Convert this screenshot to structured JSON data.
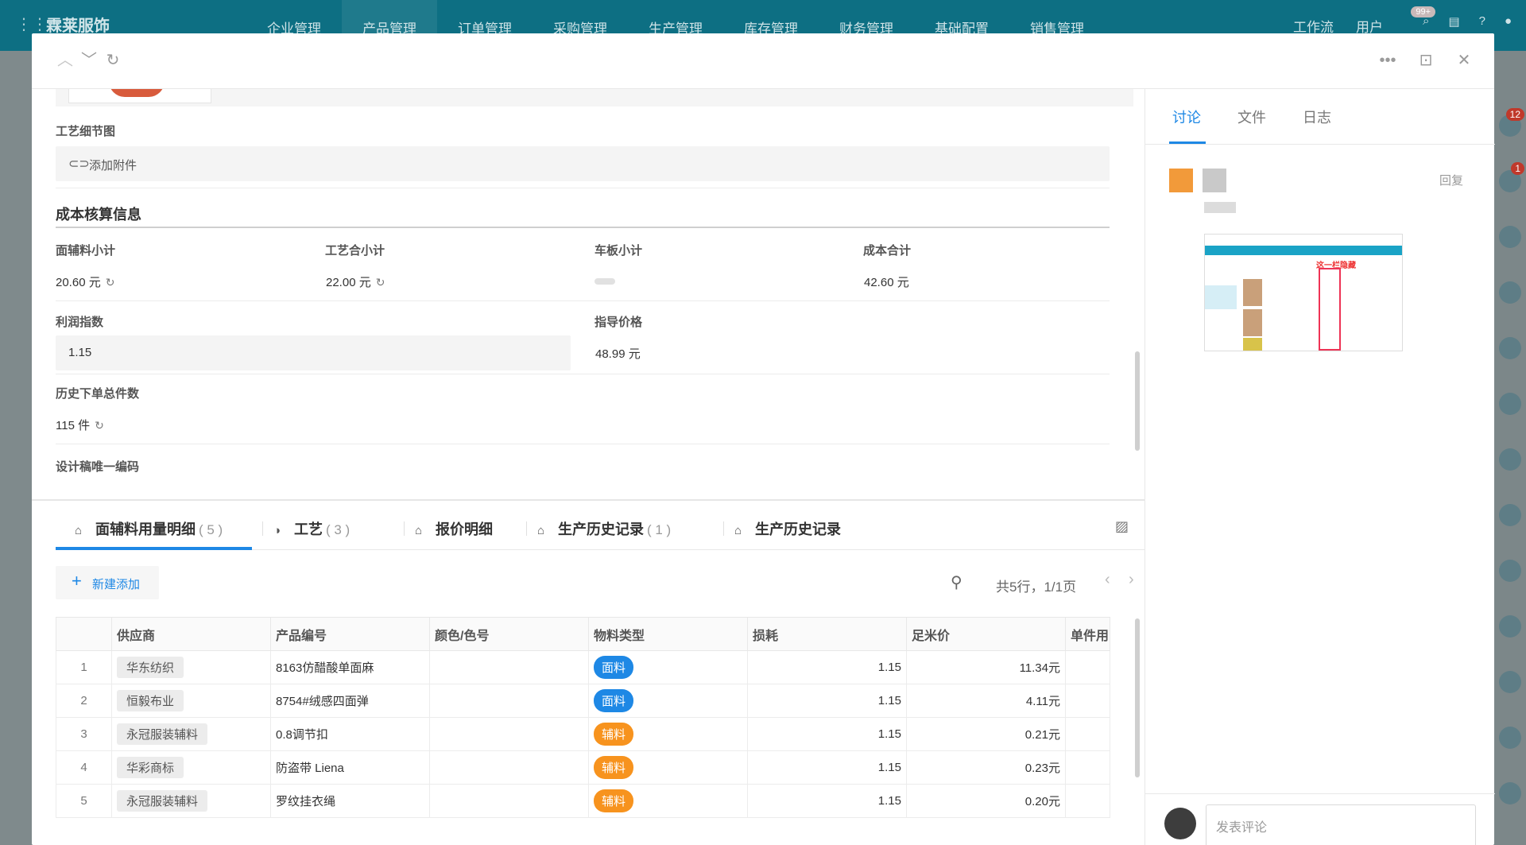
{
  "app": {
    "brand": "霖莱服饰",
    "nav": [
      "企业管理",
      "产品管理",
      "订单管理",
      "采购管理",
      "生产管理",
      "库存管理",
      "财务管理",
      "基础配置",
      "销售管理"
    ],
    "workflow": "工作流",
    "users": "用户",
    "notify_badge": "99+",
    "side_badges": [
      "12",
      "1"
    ]
  },
  "modal": {
    "icons": [
      "chevron-up-icon",
      "chevron-down-icon",
      "refresh-icon",
      "more-icon",
      "collapse-panel-icon",
      "close-icon"
    ]
  },
  "detail": {
    "craft_image_label": "工艺细节图",
    "attach_label": "添加附件",
    "cost_section_title": "成本核算信息",
    "fabric_subtotal_label": "面辅料小计",
    "fabric_subtotal_value": "20.60 元",
    "craft_subtotal_label": "工艺合小计",
    "craft_subtotal_value": "22.00 元",
    "pattern_subtotal_label": "车板小计",
    "cost_total_label": "成本合计",
    "cost_total_value": "42.60 元",
    "profit_index_label": "利润指数",
    "profit_index_value": "1.15",
    "guide_price_label": "指导价格",
    "guide_price_value": "48.99 元",
    "history_qty_label": "历史下单总件数",
    "history_qty_value": "115 件",
    "cutoff_label": "设计稿唯一编码"
  },
  "tabs": [
    {
      "label": "面辅料用量明细",
      "count": "( 5 )",
      "icon": "home-icon"
    },
    {
      "label": "工艺",
      "count": "( 3 )",
      "icon": "craft-icon"
    },
    {
      "label": "报价明细",
      "count": "",
      "icon": "home-icon"
    },
    {
      "label": "生产历史记录",
      "count": "( 1 )",
      "icon": "home-icon"
    },
    {
      "label": "生产历史记录",
      "count": "",
      "icon": "home-icon"
    }
  ],
  "toolbar": {
    "add_label": "新建添加",
    "pager": "共5行，1/1页"
  },
  "table": {
    "columns": [
      "",
      "供应商",
      "产品编号",
      "颜色/色号",
      "物料类型",
      "损耗",
      "足米价",
      "单件用"
    ],
    "rows": [
      {
        "idx": "1",
        "supplier": "华东纺织",
        "code": "8163仿醋酸单面麻",
        "color": "",
        "type": "面料",
        "loss": "1.15",
        "price": "11.34元"
      },
      {
        "idx": "2",
        "supplier": "恒毅布业",
        "code": "8754#绒感四面弹",
        "color": "",
        "type": "面料",
        "loss": "1.15",
        "price": "4.11元"
      },
      {
        "idx": "3",
        "supplier": "永冠服装辅料",
        "code": "0.8调节扣",
        "color": "",
        "type": "辅料",
        "loss": "1.15",
        "price": "0.21元"
      },
      {
        "idx": "4",
        "supplier": "华彩商标",
        "code": "防盗带 Liena",
        "color": "",
        "type": "辅料",
        "loss": "1.15",
        "price": "0.23元"
      },
      {
        "idx": "5",
        "supplier": "永冠服装辅料",
        "code": "罗纹挂衣绳",
        "color": "",
        "type": "辅料",
        "loss": "1.15",
        "price": "0.20元"
      }
    ],
    "type_colors": {
      "面料": "#1e88e5",
      "辅料": "#f7931e"
    }
  },
  "right": {
    "tabs": [
      "讨论",
      "文件",
      "日志"
    ],
    "reply": "回复",
    "shot_caption": "这一栏隐藏",
    "comment_placeholder": "发表评论"
  }
}
